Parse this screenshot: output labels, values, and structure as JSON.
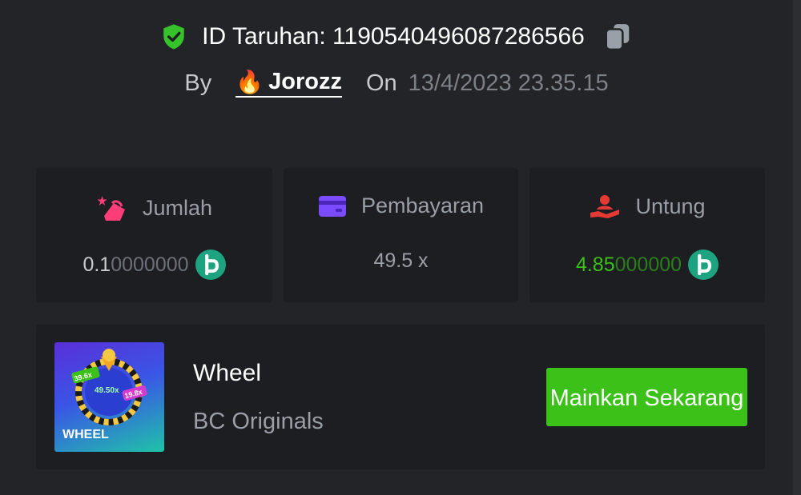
{
  "header": {
    "bet_id_label": "ID Taruhan: 1190540496087286566",
    "by_label": "By",
    "username": "Jorozz",
    "on_label": "On",
    "date": "13/4/2023 23.35.15"
  },
  "cards": [
    {
      "label": "Jumlah",
      "value_main": "0.1",
      "value_dim": "0000000",
      "icon": "bet-amount-icon"
    },
    {
      "label": "Pembayaran",
      "value": "49.5 x",
      "icon": "payment-card-icon"
    },
    {
      "label": "Untung",
      "value_main": "4.85",
      "value_dim": "000000",
      "icon": "profit-hand-icon"
    }
  ],
  "game": {
    "title": "Wheel",
    "provider": "BC Originals",
    "thumb_text": "WHEEL",
    "thumb_chips": [
      "39.6x",
      "49.50x",
      "19.8x"
    ],
    "play_label": "Mainkan Sekarang"
  },
  "colors": {
    "accent_green": "#3bc117",
    "background": "#232427",
    "card": "#1d1e21"
  }
}
